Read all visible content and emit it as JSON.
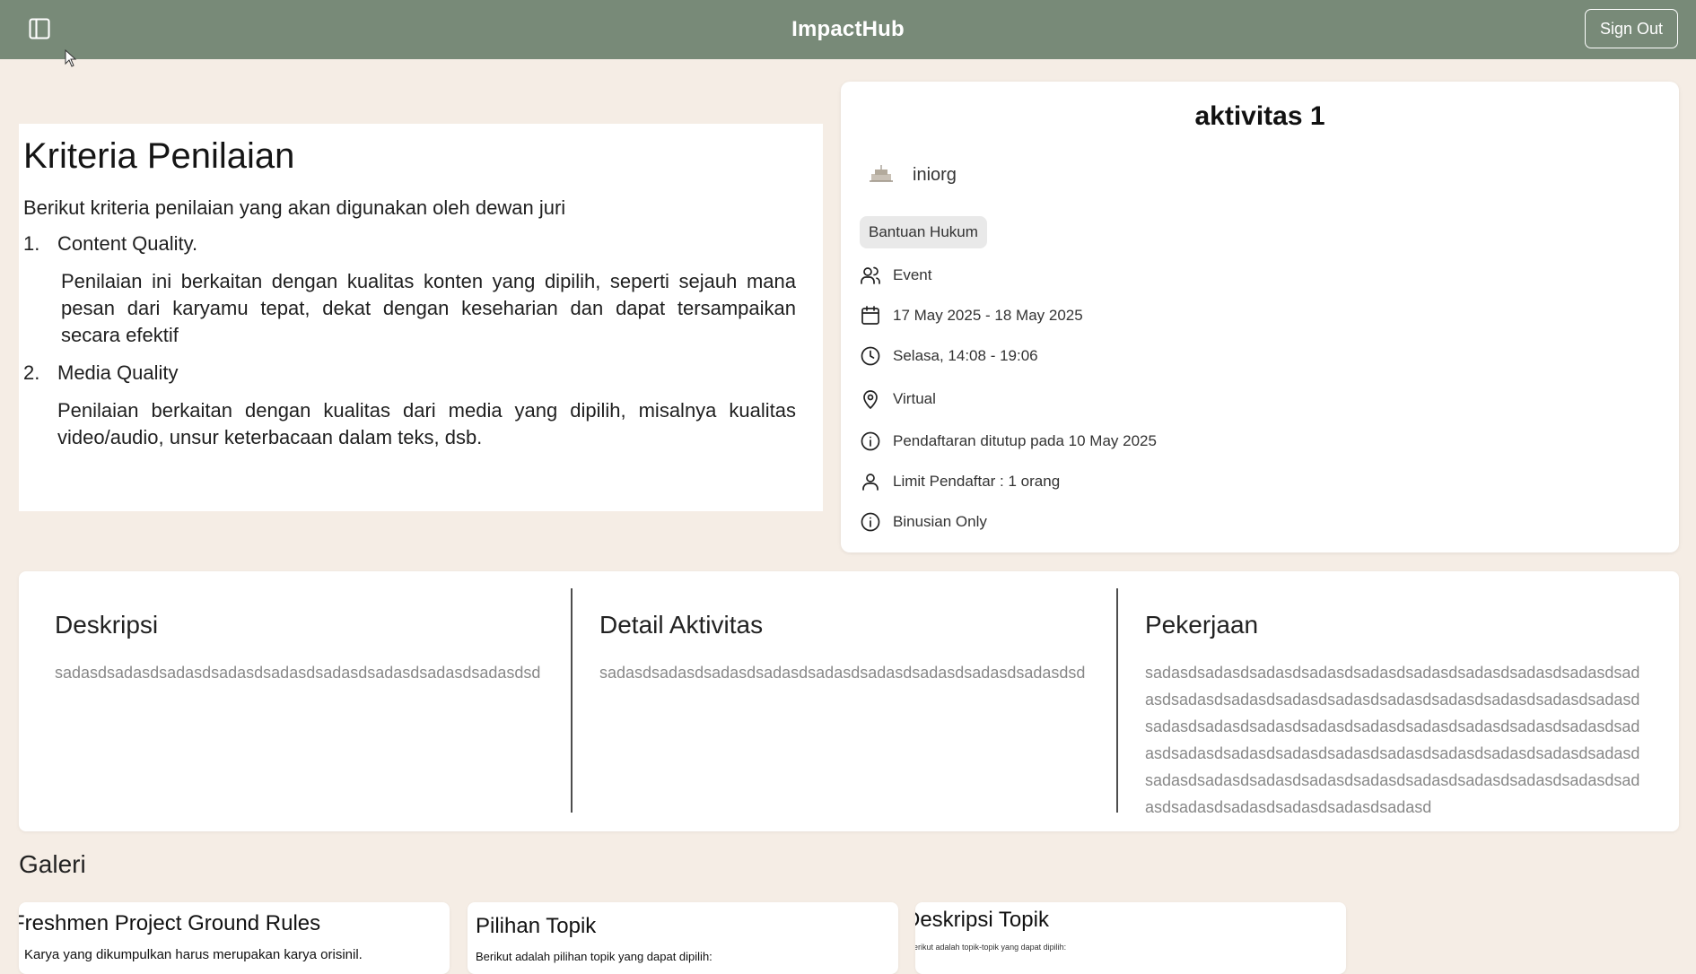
{
  "header": {
    "brand": "ImpactHub",
    "sign_out_label": "Sign Out",
    "icons": {
      "sidebar_toggle": "sidebar-toggle-icon"
    }
  },
  "criteria": {
    "title": "Kriteria Penilaian",
    "intro": "Berikut kriteria penilaian yang akan digunakan oleh dewan juri",
    "items": [
      {
        "number": "1.",
        "title": "Content Quality.",
        "description": "Penilaian ini berkaitan dengan kualitas konten yang dipilih, seperti sejauh mana pesan dari karyamu tepat, dekat dengan keseharian dan dapat tersampaikan secara efektif"
      },
      {
        "number": "2.",
        "title": "Media Quality",
        "description": "Penilaian berkaitan dengan kualitas dari media yang dipilih, misalnya kualitas video/audio, unsur keterbacaan dalam teks, dsb."
      }
    ]
  },
  "activity": {
    "title": "aktivitas 1",
    "organizer": "iniorg",
    "tag": "Bantuan Hukum",
    "details": [
      {
        "icon": "users-icon",
        "text": "Event"
      },
      {
        "icon": "calendar-icon",
        "text": "17 May 2025 - 18 May 2025"
      },
      {
        "icon": "clock-icon",
        "text": "Selasa, 14:08 - 19:06"
      },
      {
        "icon": "map-pin-icon",
        "text": "Virtual"
      },
      {
        "icon": "info-icon",
        "text": "Pendaftaran ditutup pada 10 May 2025"
      },
      {
        "icon": "user-icon",
        "text": "Limit Pendaftar : 1 orang"
      },
      {
        "icon": "info-icon",
        "text": "Binusian Only"
      }
    ]
  },
  "sections": {
    "deskripsi": {
      "title": "Deskripsi",
      "body": "sadasdsadasdsadasdsadasdsadasdsadasdsadasdsadasdsadasdsd"
    },
    "detail": {
      "title": "Detail Aktivitas",
      "body": "sadasdsadasdsadasdsadasdsadasdsadasdsadasdsadasdsadasdsd"
    },
    "pekerjaan": {
      "title": "Pekerjaan",
      "body": "sadasdsadasdsadasdsadasdsadasdsadasdsadasdsadasdsadasdsadasdsadasdsadasdsadasdsadasdsadasdsadasdsadasdsadasdsadasdsadasdsadasdsadasdsadasdsadasdsadasdsadasdsadasdsadasdsadasdsadasdsadasdsadasdsadasdsadasdsadasdsadasdsadasdsadasdsadasdsadasdsadasdsadasdsadasdsadasdsadasdsadasdsadasdsadasdsadasdsadasdsadasdsadasdsadasd"
    }
  },
  "gallery": {
    "title": "Galeri",
    "items": [
      {
        "title": "Freshmen Project Ground Rules",
        "subtitle": "Karya yang dikumpulkan harus merupakan karya orisinil."
      },
      {
        "title": "Pilihan Topik",
        "subtitle": "Berikut adalah pilihan topik yang dapat dipilih:"
      },
      {
        "title": "Deskripsi Topik",
        "subtitle": "Berikut adalah topik-topik yang dapat dipilih:"
      }
    ]
  },
  "colors": {
    "header_bg": "#788a78",
    "page_bg": "#f5ede5",
    "card_bg": "#ffffff",
    "muted_text": "#888888"
  }
}
